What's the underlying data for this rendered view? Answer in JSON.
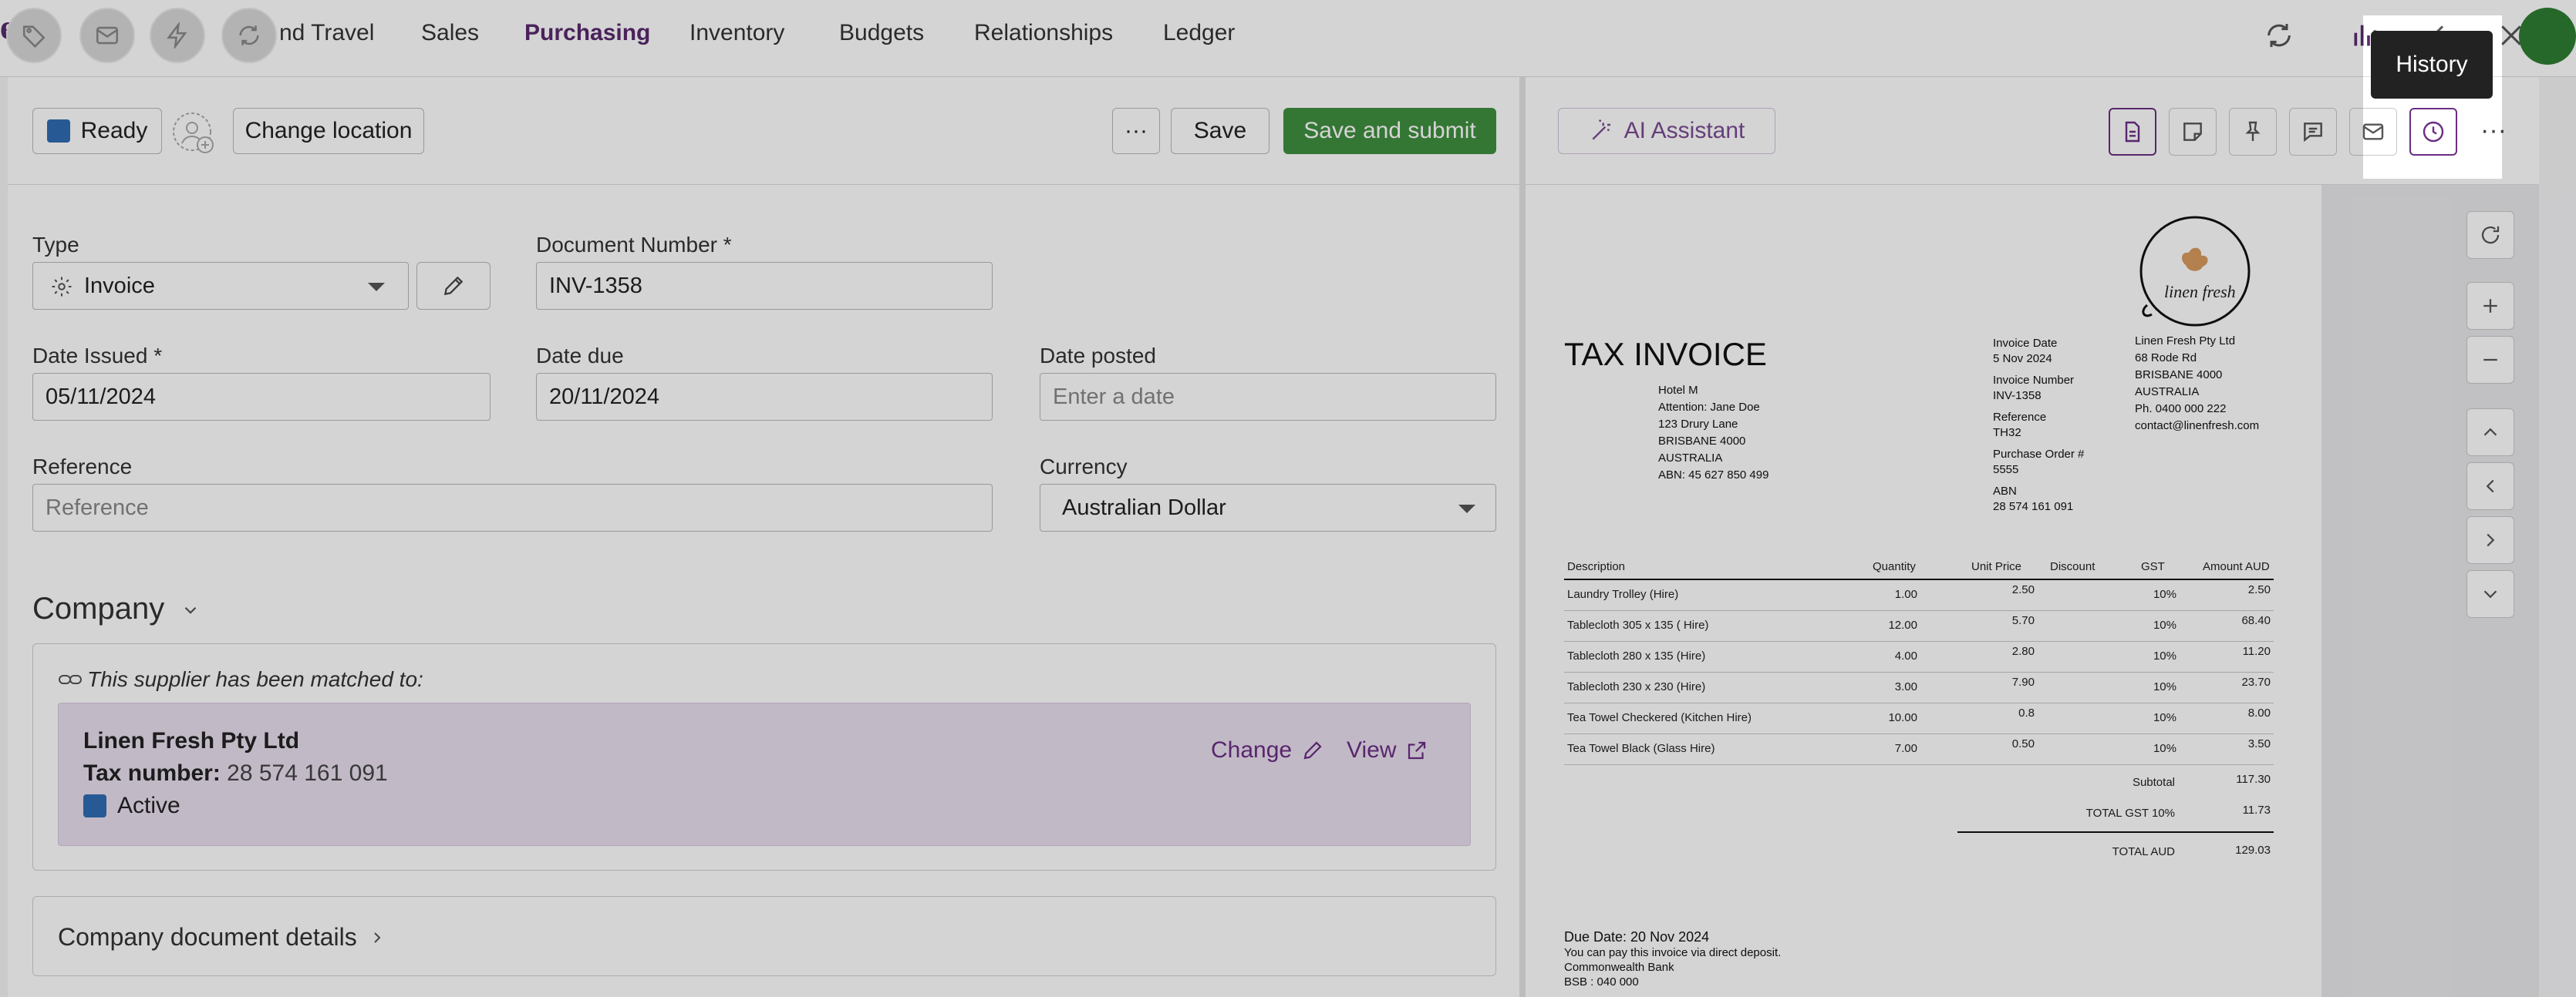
{
  "nav": {
    "items": [
      "nd Travel",
      "Sales",
      "Purchasing",
      "Inventory",
      "Budgets",
      "Relationships",
      "Ledger"
    ],
    "active": "Purchasing"
  },
  "toolbar": {
    "status": "Ready",
    "change_location": "Change location",
    "more": "···",
    "save": "Save",
    "save_submit": "Save and submit"
  },
  "form": {
    "type_label": "Type",
    "type_value": "Invoice",
    "doc_number_label": "Document Number *",
    "doc_number_value": "INV-1358",
    "date_issued_label": "Date Issued *",
    "date_issued_value": "05/11/2024",
    "date_due_label": "Date due",
    "date_due_value": "20/11/2024",
    "date_posted_label": "Date posted",
    "date_posted_placeholder": "Enter a date",
    "reference_label": "Reference",
    "reference_placeholder": "Reference",
    "currency_label": "Currency",
    "currency_value": "Australian Dollar"
  },
  "company": {
    "title": "Company",
    "match_note": "This supplier has been matched to:",
    "name": "Linen Fresh Pty Ltd",
    "tax_label": "Tax number:",
    "tax_value": "28 574 161 091",
    "status": "Active",
    "change": "Change",
    "view": "View",
    "details_title": "Company document details"
  },
  "right_panel": {
    "ai_assistant": "AI Assistant",
    "more": "···",
    "tooltip": "History"
  },
  "invoice": {
    "title": "TAX INVOICE",
    "logo_text": "linen fresh",
    "bill_to": [
      "Hotel M",
      "Attention: Jane Doe",
      "123 Drury Lane",
      "BRISBANE 4000",
      "AUSTRALIA",
      "ABN: 45 627 850 499"
    ],
    "meta": [
      {
        "label": "Invoice Date",
        "value": "5 Nov 2024"
      },
      {
        "label": "Invoice Number",
        "value": "INV-1358"
      },
      {
        "label": "Reference",
        "value": "TH32"
      },
      {
        "label": "Purchase Order #",
        "value": "5555"
      },
      {
        "label": "ABN",
        "value": "28 574 161 091"
      }
    ],
    "supplier": [
      "Linen Fresh Pty Ltd",
      "68 Rode Rd",
      "BRISBANE 4000",
      "AUSTRALIA",
      "Ph. 0400 000 222",
      "contact@linenfresh.com"
    ],
    "columns": [
      "Description",
      "Quantity",
      "Unit Price",
      "Discount",
      "GST",
      "Amount AUD"
    ],
    "rows": [
      {
        "desc": "Laundry Trolley (Hire)",
        "qty": "1.00",
        "price": "2.50",
        "gst": "10%",
        "amount": "2.50"
      },
      {
        "desc": "Tablecloth 305 x 135 ( Hire)",
        "qty": "12.00",
        "price": "5.70",
        "gst": "10%",
        "amount": "68.40"
      },
      {
        "desc": "Tablecloth 280 x 135 (Hire)",
        "qty": "4.00",
        "price": "2.80",
        "gst": "10%",
        "amount": "11.20"
      },
      {
        "desc": "Tablecloth 230 x 230 (Hire)",
        "qty": "3.00",
        "price": "7.90",
        "gst": "10%",
        "amount": "23.70"
      },
      {
        "desc": "Tea Towel Checkered (Kitchen Hire)",
        "qty": "10.00",
        "price": "0.8",
        "gst": "10%",
        "amount": "8.00"
      },
      {
        "desc": "Tea Towel Black (Glass Hire)",
        "qty": "7.00",
        "price": "0.50",
        "gst": "10%",
        "amount": "3.50"
      }
    ],
    "subtotal_label": "Subtotal",
    "subtotal": "117.30",
    "gst_label": "TOTAL  GST  10%",
    "gst": "11.73",
    "total_label": "TOTAL AUD",
    "total": "129.03",
    "footer": [
      "Due Date: 20 Nov 2024",
      "You can pay this invoice via direct deposit.",
      "Commonwealth Bank",
      "BSB : 040 000"
    ]
  }
}
